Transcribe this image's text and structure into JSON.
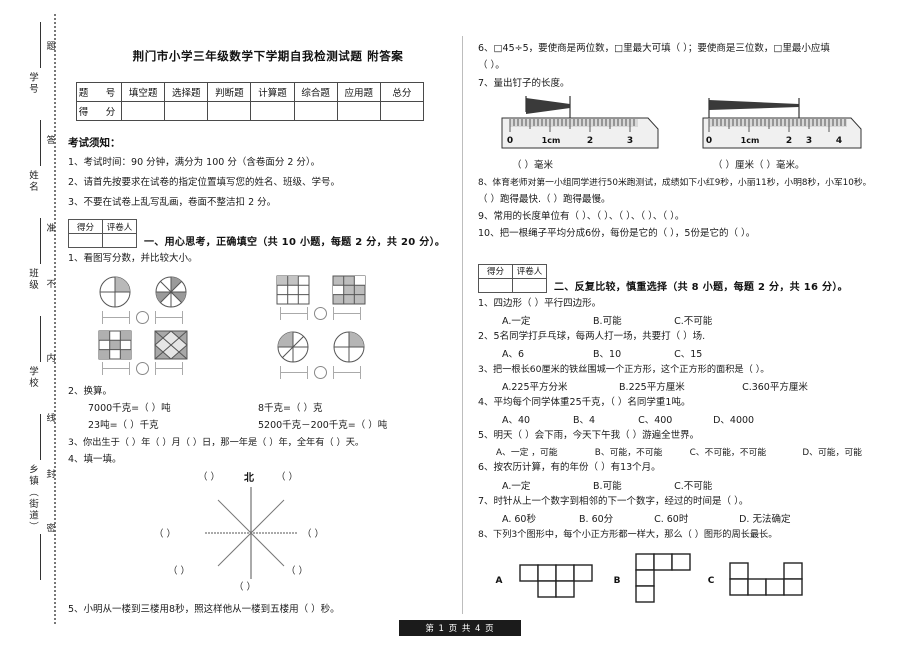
{
  "document": {
    "title": "荆门市小学三年级数学下学期自我检测试题 附答案",
    "footer": "第 1 页 共 4 页"
  },
  "seal_margin": {
    "fields": [
      "学号",
      "姓名",
      "班级",
      "学校",
      "乡镇（街道）"
    ],
    "inner_text": [
      "题",
      "答",
      "准",
      "不",
      "内",
      "线",
      "封",
      "密"
    ]
  },
  "score_table": {
    "row_headers": [
      "题　号",
      "得　分"
    ],
    "columns": [
      "填空题",
      "选择题",
      "判断题",
      "计算题",
      "综合题",
      "应用题",
      "总分"
    ],
    "values": [
      "",
      "",
      "",
      "",
      "",
      "",
      ""
    ]
  },
  "notice": {
    "heading": "考试须知：",
    "items": [
      "1、考试时间：90 分钟，满分为 100 分（含卷面分 2 分）。",
      "2、请首先按要求在试卷的指定位置填写您的姓名、班级、学号。",
      "3、不要在试卷上乱写乱画，卷面不整洁扣 2 分。"
    ]
  },
  "grader_box": {
    "score_label": "得分",
    "grader_label": "评卷人"
  },
  "section_one": {
    "title": "一、用心思考，正确填空（共 10 小题，每题 2 分，共 20 分）。",
    "q1": "1、看图写分数，并比较大小。",
    "q2": "2、换算。",
    "q2_conversions": [
      "7000千克=（    ）吨",
      "8千克=（    ）克",
      "23吨=（    ）千克",
      "5200千克－200千克=（    ）吨"
    ],
    "q3": "3、你出生于（    ）年（    ）月（    ）日，那一年是（    ）年，全年有（    ）天。",
    "q4": "4、填一填。",
    "compass": {
      "north": "北",
      "directions": [
        "（    ）",
        "（    ）",
        "（    ）",
        "（    ）",
        "（    ）",
        "（    ）",
        "（    ）"
      ]
    },
    "q5": "5、小明从一楼到三楼用8秒，照这样他从一楼到五楼用（    ）秒。",
    "q6": "6、□45÷5，要使商是两位数，□里最大可填（    ）；要使商是三位数，□里最小应填",
    "q6_cont": "（    ）。",
    "q7": "7、量出钉子的长度。",
    "ruler_captions": [
      "（    ）毫米",
      "（    ）厘米（    ）毫米。"
    ],
    "ruler_ticks_a": [
      "0",
      "1cm",
      "2",
      "3"
    ],
    "ruler_ticks_b": [
      "0",
      "1cm",
      "2",
      "3",
      "4"
    ],
    "q8": "8、体育老师对第一小组同学进行50米跑测试，成绩如下小红9秒，小丽11秒，小明8秒，小军10秒。",
    "q8_cont": "（    ）跑得最快.（    ）跑得最慢。",
    "q9": "9、常用的长度单位有（    ）、（    ）、（    ）、（    ）、（    ）。",
    "q10": "10、把一根绳子平均分成6份，每份是它的（    ），5份是它的（    ）。"
  },
  "section_two": {
    "title": "二、反复比较，慎重选择（共 8 小题，每题 2 分，共 16 分）。",
    "questions": [
      {
        "stem": "1、四边形（    ）平行四边形。",
        "options": [
          "A.一定",
          "B.可能",
          "C.不可能"
        ]
      },
      {
        "stem": "2、5名同学打乒乓球，每两人打一场，共要打（    ）场.",
        "options": [
          "A、6",
          "B、10",
          "C、15"
        ]
      },
      {
        "stem": "3、把一根长60厘米的铁丝围城一个正方形，这个正方形的面积是（    ）。",
        "options": [
          "A.225平方分米",
          "B.225平方厘米",
          "C.360平方厘米"
        ]
      },
      {
        "stem": "4、平均每个同学体重25千克，（    ）名同学重1吨。",
        "options": [
          "A、40",
          "B、4",
          "C、400",
          "D、4000"
        ]
      },
      {
        "stem": "5、明天（    ）会下雨，今天下午我（    ）游遍全世界。",
        "options": [
          "A、一定 ，可能",
          "B、可能，不可能",
          "C、不可能，不可能",
          "D、可能，可能"
        ]
      },
      {
        "stem": "6、按农历计算，有的年份（    ）有13个月。",
        "options": [
          "A.一定",
          "B.可能",
          "C.不可能"
        ]
      },
      {
        "stem": "7、时针从上一个数字到相邻的下一个数字，经过的时间是（    ）。",
        "options": [
          "A. 60秒",
          "B. 60分",
          "C. 60时",
          "D. 无法确定"
        ]
      },
      {
        "stem": "8、下列3个图形中，每个小正方形都一样大，那么（    ）图形的周长最长。",
        "options": []
      }
    ],
    "poly_labels": [
      "A",
      "B",
      "C"
    ]
  }
}
